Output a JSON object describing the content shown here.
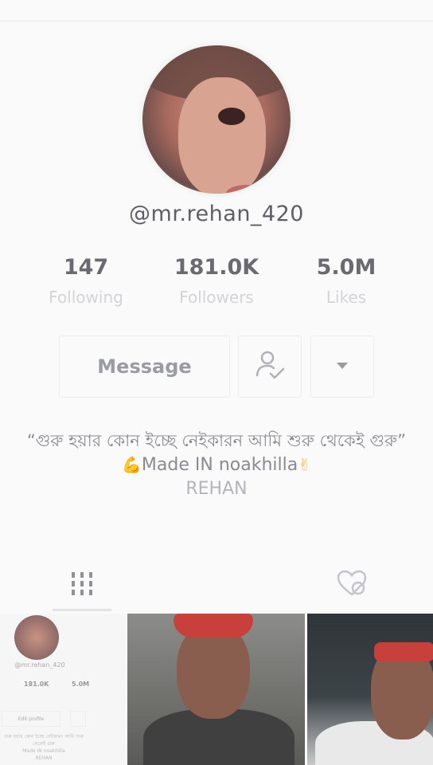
{
  "profile": {
    "username": "@mr.rehan_420"
  },
  "stats": [
    {
      "value": "147",
      "label": "Following"
    },
    {
      "value": "181.0K",
      "label": "Followers"
    },
    {
      "value": "5.0M",
      "label": "Likes"
    }
  ],
  "actions": {
    "message_label": "Message",
    "follow_icon": "person-check-icon",
    "more_icon": "caret-down-icon"
  },
  "bio": {
    "line1": "“গুরু হয়ার কোন ইচ্ছে নেইকারন আমি শুরু থেকেই গুরু”",
    "line2_emoji_left": "💪",
    "line2_text": "Made IN noakhilla",
    "line2_emoji_right": "✌",
    "line3": "REHAN"
  },
  "tabs": [
    {
      "icon": "grid-bars-icon",
      "active": true
    },
    {
      "icon": "liked-heart-icon",
      "active": false
    }
  ],
  "thumb_mini_profile": {
    "username": "@mr.rehan_420",
    "followers": "181.0K",
    "likes": "5.0M",
    "edit_label": "Edit profile",
    "bio_text": "গুরু হয়ার কোন ইচ্ছে নেইকারন আমি শুরু থেকেই গুরু",
    "bio_made": "Made IN noakhilla",
    "bio_name": "REHAN"
  }
}
